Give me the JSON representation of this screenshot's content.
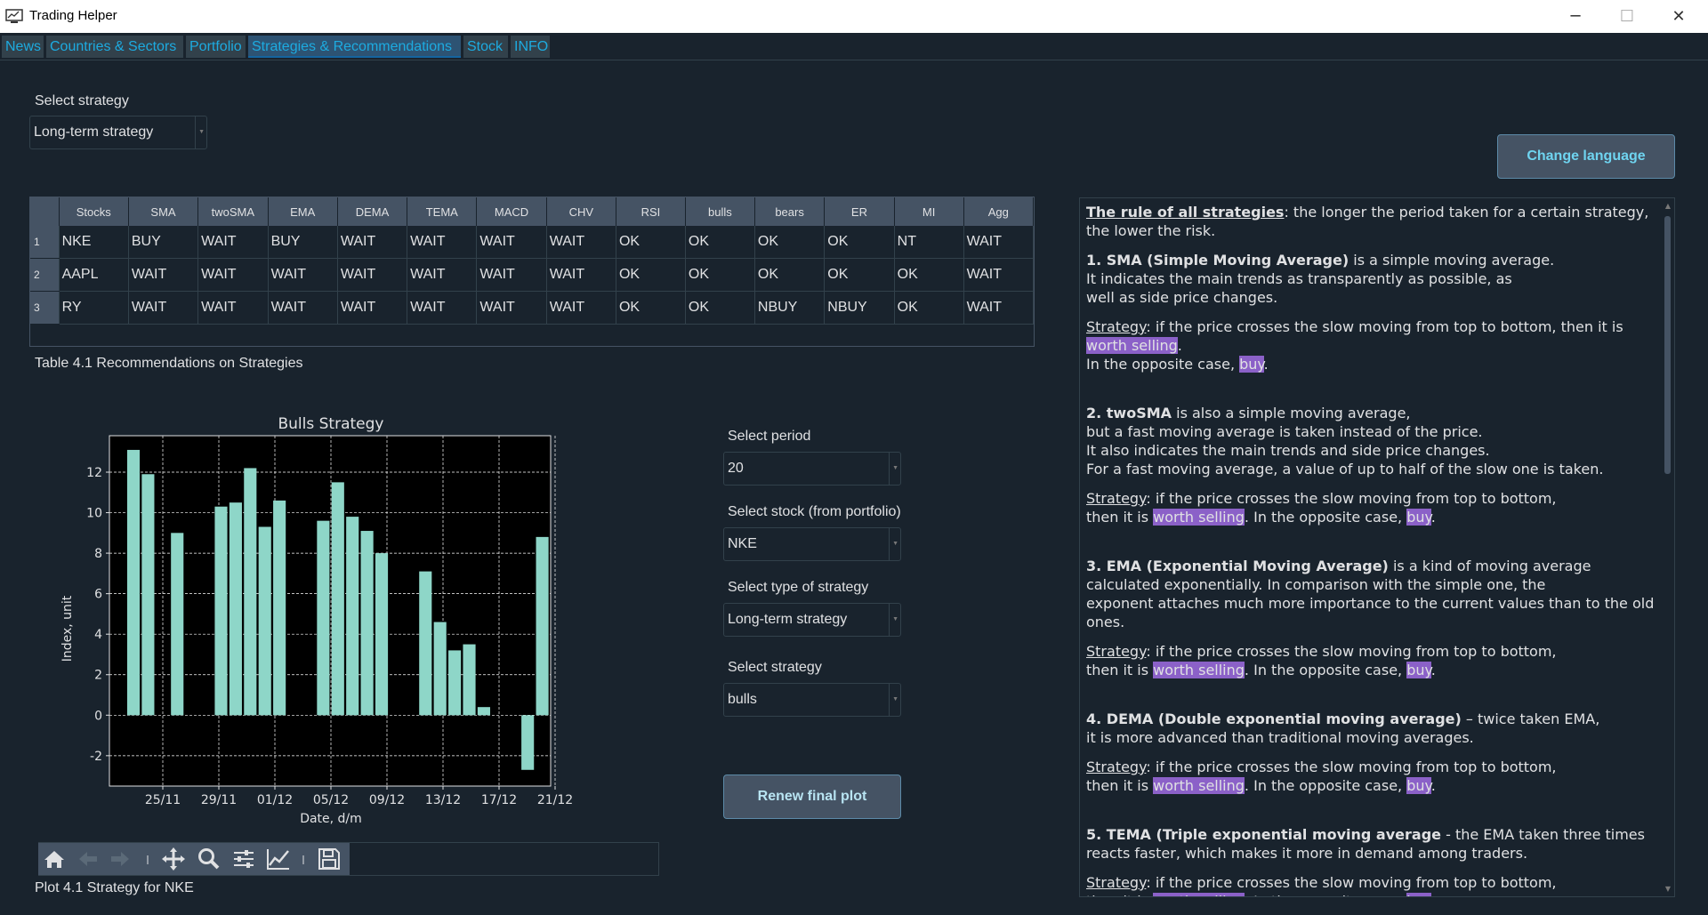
{
  "window": {
    "title": "Trading Helper",
    "minimize": "─",
    "maximize": "☐",
    "close": "✕"
  },
  "tabs": [
    {
      "label": "News",
      "active": false
    },
    {
      "label": "Countries & Sectors",
      "active": false
    },
    {
      "label": "Portfolio",
      "active": false
    },
    {
      "label": "Strategies & Recommendations",
      "active": true
    },
    {
      "label": "Stock",
      "active": false
    },
    {
      "label": "INFO",
      "active": false
    }
  ],
  "top": {
    "select_strategy_label": "Select strategy",
    "select_strategy_value": "Long-term strategy",
    "change_language": "Change language"
  },
  "table": {
    "columns": [
      "Stocks",
      "SMA",
      "twoSMA",
      "EMA",
      "DEMA",
      "TEMA",
      "MACD",
      "CHV",
      "RSI",
      "bulls",
      "bears",
      "ER",
      "MI",
      "Agg"
    ],
    "rows": [
      {
        "num": "1",
        "cells": [
          "NKE",
          "BUY",
          "WAIT",
          "BUY",
          "WAIT",
          "WAIT",
          "WAIT",
          "WAIT",
          "OK",
          "OK",
          "OK",
          "OK",
          "NT",
          "WAIT"
        ]
      },
      {
        "num": "2",
        "cells": [
          "AAPL",
          "WAIT",
          "WAIT",
          "WAIT",
          "WAIT",
          "WAIT",
          "WAIT",
          "WAIT",
          "OK",
          "OK",
          "OK",
          "OK",
          "OK",
          "WAIT"
        ]
      },
      {
        "num": "3",
        "cells": [
          "RY",
          "WAIT",
          "WAIT",
          "WAIT",
          "WAIT",
          "WAIT",
          "WAIT",
          "WAIT",
          "OK",
          "OK",
          "NBUY",
          "NBUY",
          "OK",
          "WAIT"
        ]
      }
    ],
    "caption": "Table 4.1 Recommendations on Strategies"
  },
  "controls": {
    "period_label": "Select period",
    "period_value": "20",
    "stock_label": "Select stock (from portfolio)",
    "stock_value": "NKE",
    "type_label": "Select type of strategy",
    "type_value": "Long-term strategy",
    "strategy_label": "Select strategy",
    "strategy_value": "bulls",
    "renew_button": "Renew final plot"
  },
  "plot_caption": "Plot 4.1 Strategy for NKE",
  "toolbar_icons": [
    "home-icon",
    "back-icon",
    "forward-icon",
    "pan-icon",
    "zoom-icon",
    "configure-subplots-icon",
    "edit-axis-icon",
    "save-icon"
  ],
  "chart_data": {
    "type": "bar",
    "title": "Bulls Strategy",
    "xlabel": "Date, d/m",
    "ylabel": "Index, unit",
    "ylim": [
      -3.5,
      13.8
    ],
    "yticks": [
      -2,
      0,
      2,
      4,
      6,
      8,
      10,
      12
    ],
    "xticks": [
      "25/11",
      "29/11",
      "01/12",
      "05/12",
      "09/12",
      "13/12",
      "17/12",
      "21/12"
    ],
    "bar_color": "#8ed6c8",
    "background": "#000000",
    "grid": true,
    "values": [
      13.1,
      11.9,
      null,
      9.0,
      null,
      null,
      10.3,
      10.5,
      12.2,
      9.3,
      10.6,
      null,
      null,
      9.6,
      11.5,
      9.8,
      9.1,
      8.0,
      null,
      null,
      7.1,
      4.6,
      3.2,
      3.5,
      0.4,
      null,
      null,
      -2.7,
      8.8
    ]
  },
  "info_text": {
    "rule_title": "The rule of all strategies",
    "rule_body": ": the longer the period taken for a certain strategy, the lower the risk.",
    "sma_title": "1. SMA (Simple Moving Average)",
    "sma_body": " is a simple moving average.",
    "sma_l2": "It indicates the main trends as transparently as possible, as",
    "sma_l3": "well as side price changes.",
    "strategy_word": "Strategy",
    "sma_strat": ": if the price crosses the slow moving from top to bottom, then it is ",
    "worth_selling": "worth selling",
    "opposite_case": "In the opposite case, ",
    "buy": "buy",
    "twosma_title": "2. twoSMA",
    "twosma_body": " is also a simple moving average,",
    "twosma_l2": "but a fast moving average is taken instead of the price.",
    "twosma_l3": "It also indicates the main trends and side price changes.",
    "twosma_l4": "For a fast moving average, a value of up to half of the slow one is taken.",
    "strat_common": ": if the price crosses the slow moving from top to bottom,",
    "then_it_is": "then it is ",
    "opposite_inline": ". In the opposite case, ",
    "ema_title": "3. EMA (Exponential Moving Average)",
    "ema_body": " is a kind of moving average",
    "ema_l2": "calculated exponentially. In comparison with the simple one, the",
    "ema_l3": "exponent attaches much more importance to the current values than to the old ones.",
    "dema_title": "4. DEMA (Double exponential moving average)",
    "dema_body": " – twice taken EMA,",
    "dema_l2": "it is more advanced than traditional moving averages.",
    "tema_title": "5. TEMA (Triple exponential moving average",
    "tema_body": " - the EMA taken three times",
    "tema_l2": "reacts faster, which makes it more in demand among traders."
  }
}
